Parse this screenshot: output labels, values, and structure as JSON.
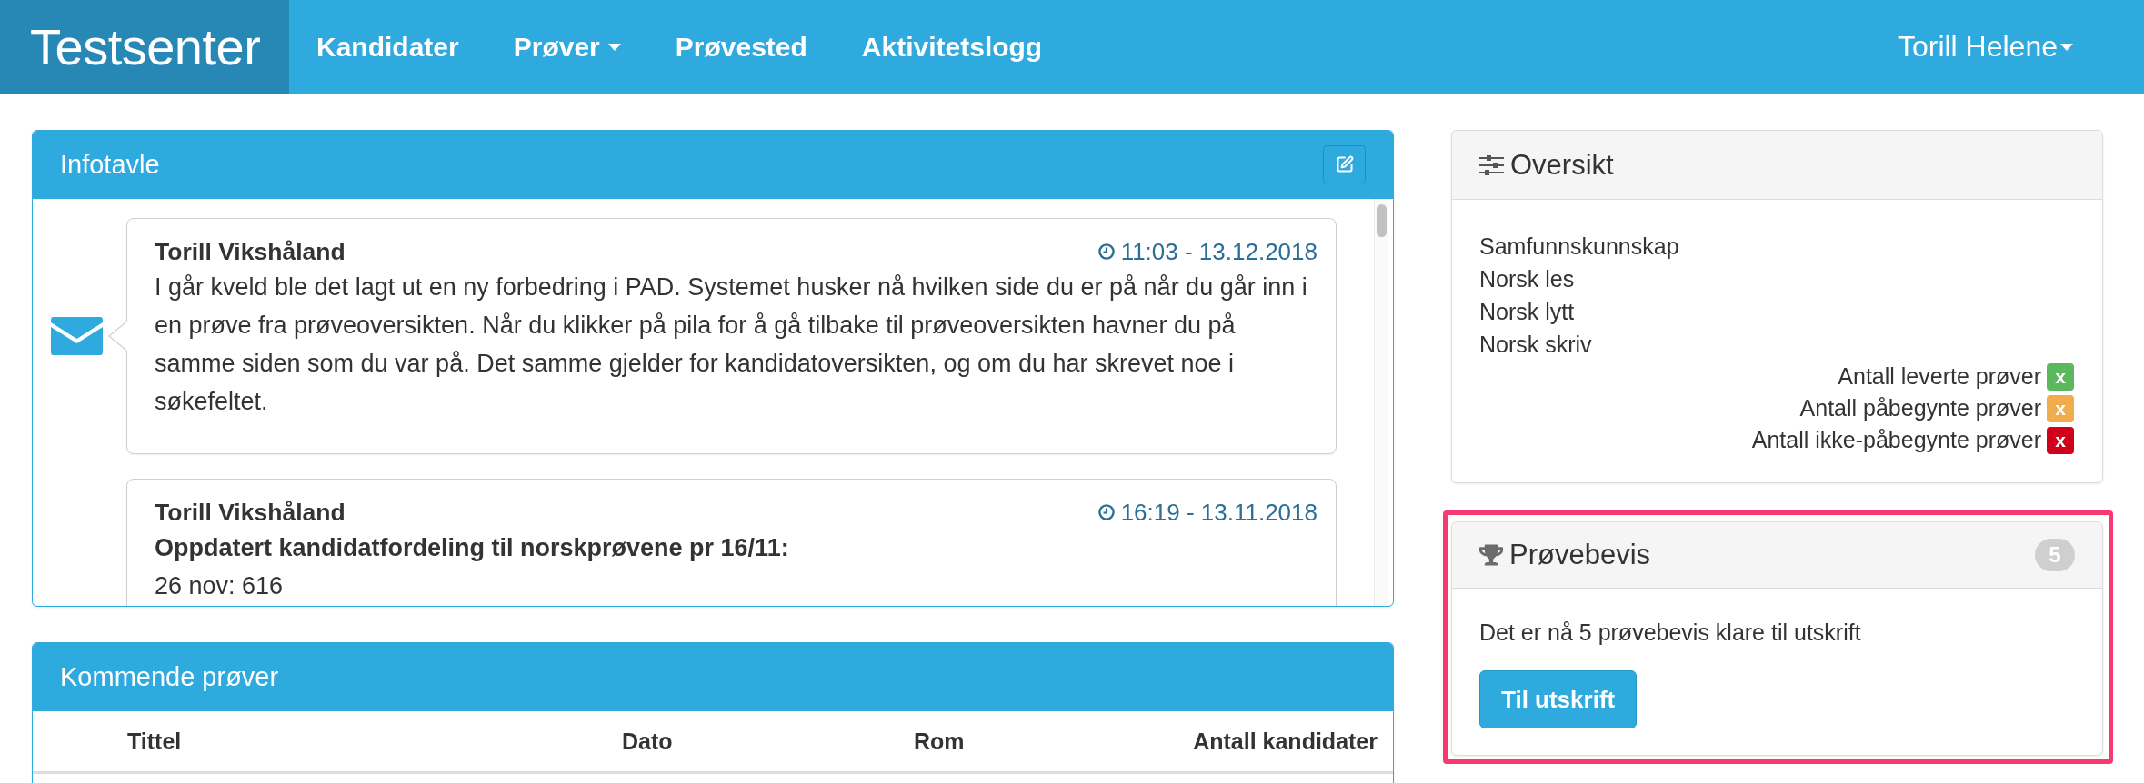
{
  "navbar": {
    "brand": "Testsenter",
    "items": [
      {
        "label": "Kandidater",
        "dropdown": false
      },
      {
        "label": "Prøver",
        "dropdown": true
      },
      {
        "label": "Prøvested",
        "dropdown": false
      },
      {
        "label": "Aktivitetslogg",
        "dropdown": false
      }
    ],
    "user": {
      "label": "Torill Helene",
      "dropdown": true
    }
  },
  "infotavle": {
    "title": "Infotavle",
    "messages": [
      {
        "kind": "marked",
        "author": "Torill Vikshåland",
        "time": "11:03 - 13.12.2018",
        "text": "I går kveld ble det lagt ut en ny forbedring i PAD. Systemet husker nå hvilken side du er på når du går inn i en prøve fra prøveoversikten. Når du klikker på pila for å gå tilbake til prøveoversikten havner du på samme siden som du var på. Det samme gjelder for kandidatoversikten, og om du har skrevet noe i søkefeltet."
      },
      {
        "kind": "plain",
        "author": "Torill Vikshåland",
        "time": "16:19 - 13.11.2018",
        "subject": "Oppdatert kandidatfordeling til norskprøvene pr 16/11:",
        "text": "26 nov: 616"
      }
    ]
  },
  "upcoming": {
    "title": "Kommende prøver",
    "columns": [
      "Tittel",
      "Dato",
      "Rom",
      "Antall kandidater"
    ]
  },
  "overview": {
    "title": "Oversikt",
    "items": [
      "Samfunnskunnskap",
      "Norsk les",
      "Norsk lytt",
      "Norsk skriv"
    ],
    "legend": [
      {
        "label": "Antall leverte prøver",
        "badge": "x",
        "color": "#5cb85c"
      },
      {
        "label": "Antall påbegynte prøver",
        "badge": "x",
        "color": "#f0ad4e"
      },
      {
        "label": "Antall ikke-påbegynte prøver",
        "badge": "x",
        "color": "#d0021b"
      }
    ]
  },
  "certificates": {
    "title": "Prøvebevis",
    "count": "5",
    "text": "Det er nå 5 prøvebevis klare til utskrift",
    "button": "Til utskrift",
    "highlighted": true
  }
}
